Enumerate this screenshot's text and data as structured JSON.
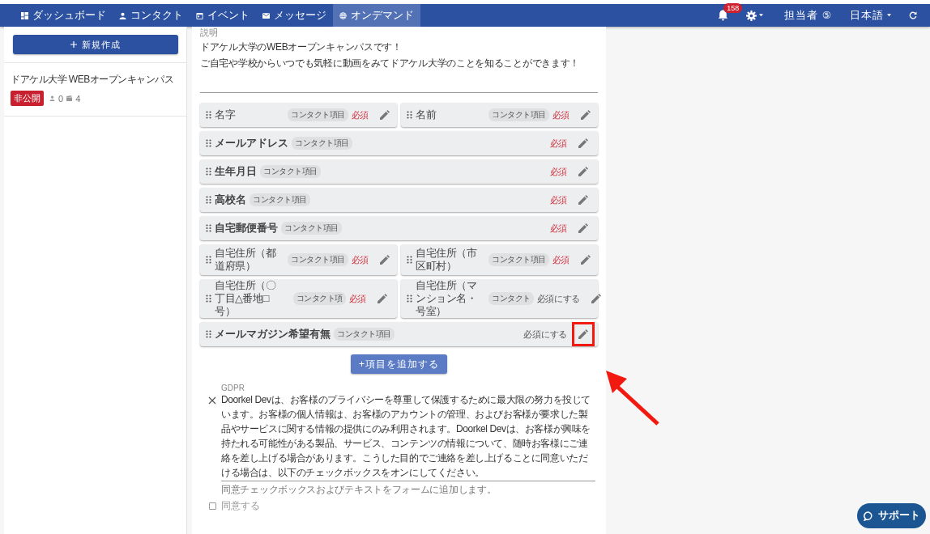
{
  "nav": {
    "items": [
      {
        "label": "ダッシュボード",
        "selected": false
      },
      {
        "label": "コンタクト",
        "selected": false
      },
      {
        "label": "イベント",
        "selected": false
      },
      {
        "label": "メッセージ",
        "selected": false
      },
      {
        "label": "オンデマンド",
        "selected": true
      }
    ],
    "notification_count": "158",
    "staff": "担当者 ⑤",
    "language": "日本語"
  },
  "sidebar": {
    "new_button": "新規作成",
    "items": [
      {
        "title": "ドアケル大学 WEBオープンキャンパス",
        "status": "非公開",
        "contacts": "0",
        "videos": "4"
      }
    ]
  },
  "description": {
    "label": "説明",
    "lines": [
      "ドアケル大学のWEBオープンキャンパスです！",
      "ご自宅や学校からいつでも気軽に動画をみてドアケル大学のことを知ることができます！"
    ]
  },
  "field_rows": [
    {
      "items": [
        {
          "label": "名字",
          "tag": "コンタクト項目",
          "requirement": "必須",
          "required": true,
          "highlighted": false
        },
        {
          "label": "名前",
          "tag": "コンタクト項目",
          "requirement": "必須",
          "required": true,
          "highlighted": false
        }
      ]
    },
    {
      "items": [
        {
          "label": "メールアドレス",
          "tag": "コンタクト項目",
          "requirement": "必須",
          "required": true,
          "highlighted": false
        }
      ]
    },
    {
      "items": [
        {
          "label": "生年月日",
          "tag": "コンタクト項目",
          "requirement": "必須",
          "required": true,
          "highlighted": false
        }
      ]
    },
    {
      "items": [
        {
          "label": "高校名",
          "tag": "コンタクト項目",
          "requirement": "必須",
          "required": true,
          "highlighted": false
        }
      ]
    },
    {
      "items": [
        {
          "label": "自宅郵便番号",
          "tag": "コンタクト項目",
          "requirement": "必須",
          "required": true,
          "highlighted": false
        }
      ]
    },
    {
      "items": [
        {
          "label": "自宅住所（都道府県）",
          "tag": "コンタクト項目",
          "requirement": "必須",
          "required": true,
          "highlighted": false
        },
        {
          "label": "自宅住所（市区町村）",
          "tag": "コンタクト項目",
          "requirement": "必須",
          "required": true,
          "highlighted": false
        }
      ]
    },
    {
      "items": [
        {
          "label": "自宅住所（〇丁目△番地□号）",
          "tag": "コンタクト項",
          "requirement": "必須",
          "required": true,
          "highlighted": false
        },
        {
          "label": "自宅住所（マンション名・号室）",
          "tag": "コンタクト",
          "requirement": "必須にする",
          "required": false,
          "highlighted": false
        }
      ]
    },
    {
      "items": [
        {
          "label": "メールマガジン希望有無",
          "tag": "コンタクト項目",
          "requirement": "必須にする",
          "required": false,
          "highlighted": true
        }
      ]
    }
  ],
  "add_button": "+項目を追加する",
  "gdpr": {
    "label": "GDPR",
    "text": "Doorkel Devは、お客様のプライバシーを尊重して保護するために最大限の努力を投じています。お客様の個人情報は、お客様のアカウントの管理、およびお客様が要求した製品やサービスに関する情報の提供にのみ利用されます。Doorkel Devは、お客様が興味を持たれる可能性がある製品、サービス、コンテンツの情報について、随時お客様にご連絡を差し上げる場合があります。こうした目的でご連絡を差し上げることに同意いただける場合は、以下のチェックボックスをオンにしてください。",
    "helper": "同意チェックボックスおよびテキストをフォームに追加します。",
    "consent": {
      "label": "同意する",
      "checked": false
    }
  },
  "support_button": "サポート"
}
